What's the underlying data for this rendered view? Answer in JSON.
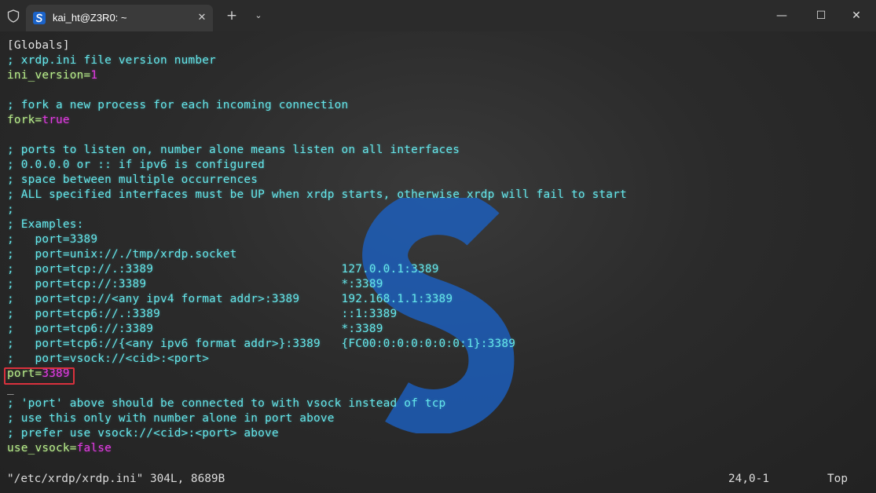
{
  "window": {
    "tab_title": "kai_ht@Z3R0: ~",
    "tab_close": "✕",
    "new_tab": "+",
    "dropdown": "⌄",
    "minimize": "—",
    "maximize": "☐",
    "close": "✕",
    "icons": {
      "shield": "shield-icon",
      "tab": "terminal-app-icon"
    }
  },
  "editor": {
    "lines": [
      {
        "type": "section",
        "text": "[Globals]"
      },
      {
        "type": "comment",
        "text": "; xrdp.ini file version number"
      },
      {
        "type": "kv",
        "key": "ini_version=",
        "value": "1"
      },
      {
        "type": "blank",
        "text": ""
      },
      {
        "type": "comment",
        "text": "; fork a new process for each incoming connection"
      },
      {
        "type": "kv",
        "key": "fork=",
        "value": "true"
      },
      {
        "type": "blank",
        "text": ""
      },
      {
        "type": "comment",
        "text": "; ports to listen on, number alone means listen on all interfaces"
      },
      {
        "type": "comment",
        "text": "; 0.0.0.0 or :: if ipv6 is configured"
      },
      {
        "type": "comment",
        "text": "; space between multiple occurrences"
      },
      {
        "type": "comment",
        "text": "; ALL specified interfaces must be UP when xrdp starts, otherwise xrdp will fail to start"
      },
      {
        "type": "comment",
        "text": ";"
      },
      {
        "type": "comment",
        "text": "; Examples:"
      },
      {
        "type": "comment",
        "text": ";   port=3389"
      },
      {
        "type": "comment",
        "text": ";   port=unix://./tmp/xrdp.socket"
      },
      {
        "type": "comment",
        "text": ";   port=tcp://.:3389                           127.0.0.1:3389"
      },
      {
        "type": "comment",
        "text": ";   port=tcp://:3389                            *:3389"
      },
      {
        "type": "comment",
        "text": ";   port=tcp://<any ipv4 format addr>:3389      192.168.1.1:3389"
      },
      {
        "type": "comment",
        "text": ";   port=tcp6://.:3389                          ::1:3389"
      },
      {
        "type": "comment",
        "text": ";   port=tcp6://:3389                           *:3389"
      },
      {
        "type": "comment",
        "text": ";   port=tcp6://{<any ipv6 format addr>}:3389   {FC00:0:0:0:0:0:0:1}:3389"
      },
      {
        "type": "comment",
        "text": ";   port=vsock://<cid>:<port>"
      },
      {
        "type": "kv",
        "key": "port=",
        "value": "3389"
      },
      {
        "type": "plain",
        "text": "_"
      },
      {
        "type": "comment",
        "text": "; 'port' above should be connected to with vsock instead of tcp"
      },
      {
        "type": "comment",
        "text": "; use this only with number alone in port above"
      },
      {
        "type": "comment",
        "text": "; prefer use vsock://<cid>:<port> above"
      },
      {
        "type": "kv",
        "key": "use_vsock=",
        "value": "false"
      }
    ],
    "status": {
      "file": "\"/etc/xrdp/xrdp.ini\" 304L, 8689B",
      "position": "24,0-1",
      "scroll": "Top"
    }
  },
  "colors": {
    "comment": "#64e6ea",
    "key": "#b9ef8c",
    "value": "#e33be4",
    "highlight": "#d9313d",
    "watermark": "#1b63c9"
  }
}
